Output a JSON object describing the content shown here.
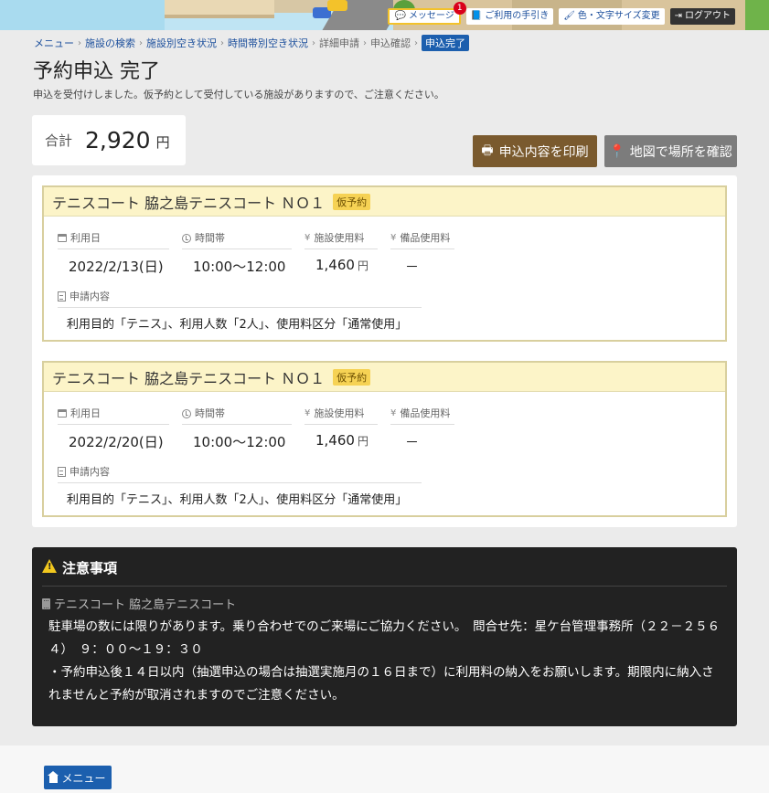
{
  "header": {
    "nav": {
      "messages_label": "メッセージ",
      "messages_count": "1",
      "guide_label": "ご利用の手引き",
      "display_label": "色・文字サイズ変更",
      "logout_label": "ログアウト"
    }
  },
  "breadcrumb": {
    "items": [
      "メニュー",
      "施設の検索",
      "施設別空き状況",
      "時間帯別空き状況",
      "詳細申請",
      "申込確認",
      "申込完了"
    ]
  },
  "page": {
    "title": "予約申込 完了",
    "subtitle": "申込を受付けしました。仮予約として受付している施設がありますので、ご注意ください。"
  },
  "total": {
    "label": "合計",
    "amount": "2,920",
    "unit": "円"
  },
  "actions": {
    "print_label": "申込内容を印刷",
    "map_label": "地図で場所を確認"
  },
  "labels": {
    "date": "利用日",
    "time": "時間帯",
    "facility_fee": "施設使用料",
    "equipment_fee": "備品使用料",
    "content": "申請内容",
    "yen": "円"
  },
  "reservations": [
    {
      "facility": "テニスコート 脇之島テニスコート ＮＯ１",
      "status": "仮予約",
      "date": "2022/2/13(日)",
      "time": "10:00〜12:00",
      "facility_fee": "1,460",
      "equipment_fee": "－",
      "content": "利用目的「テニス」、利用人数「2人」、使用料区分「通常使用」"
    },
    {
      "facility": "テニスコート 脇之島テニスコート ＮＯ１",
      "status": "仮予約",
      "date": "2022/2/20(日)",
      "time": "10:00〜12:00",
      "facility_fee": "1,460",
      "equipment_fee": "－",
      "content": "利用目的「テニス」、利用人数「2人」、使用料区分「通常使用」"
    }
  ],
  "notice": {
    "title": "注意事項",
    "facility": "テニスコート 脇之島テニスコート",
    "lines": [
      "駐車場の数には限りがあります。乗り合わせでのご来場にご協力ください。　問合せ先：星ケ台管理事務所（２２－２５６４）　９：００〜１９：３０",
      "・予約申込後１４日以内（抽選申込の場合は抽選実施月の１６日まで）に利用料の納入をお願いします。期限内に納入されませんと予約が取消されますのでご注意ください。"
    ]
  },
  "footer": {
    "menu_label": "メニュー"
  },
  "colors": {
    "accent_blue": "#1c5fae",
    "print_brown": "#7a5a2e",
    "tentative_badge": "#f6d254"
  }
}
